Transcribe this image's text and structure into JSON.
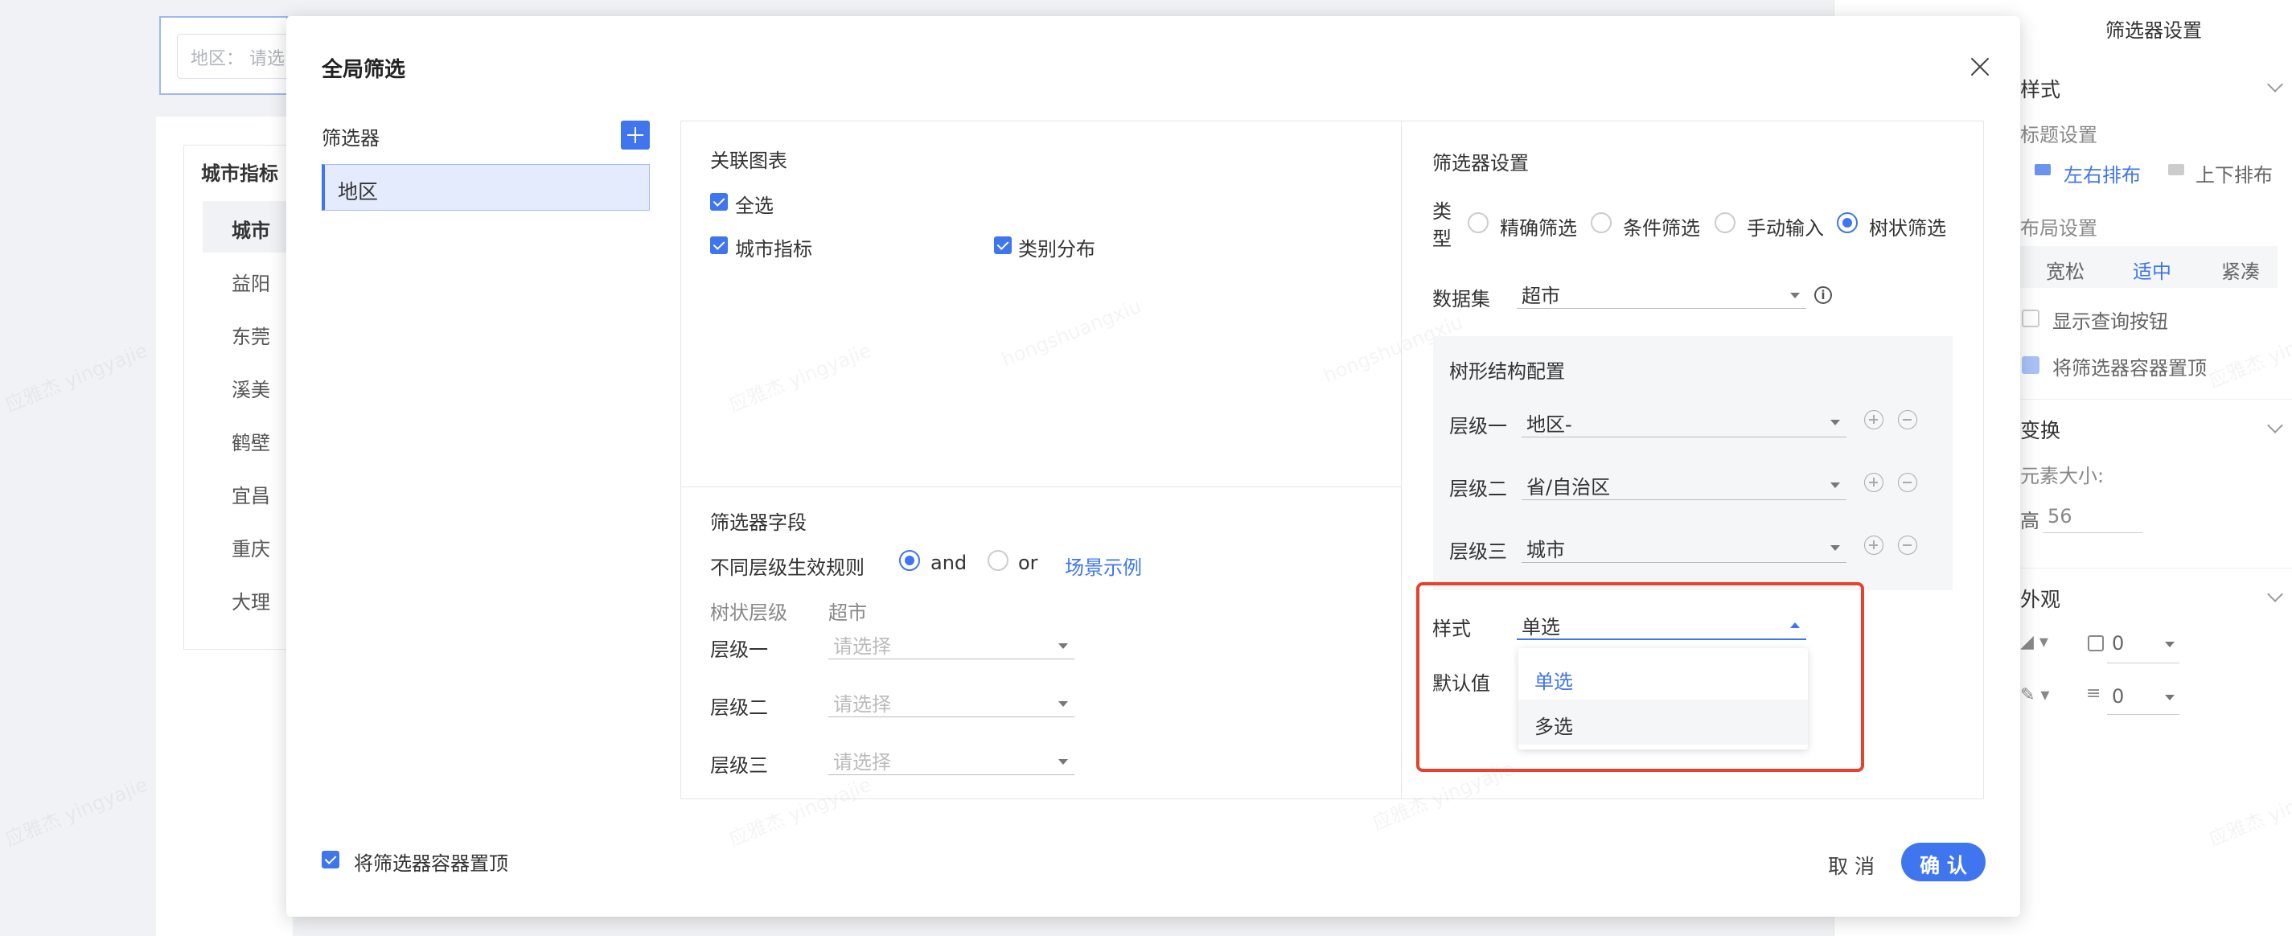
{
  "background": {
    "region_filter_placeholder": "地区： 请选",
    "card_title": "城市指标",
    "table_header": "城市",
    "rows": [
      "益阳",
      "东莞",
      "溪美",
      "鹤壁",
      "宜昌",
      "重庆",
      "大理"
    ]
  },
  "right_panel": {
    "title": "筛选器设置",
    "style_section": "样式",
    "title_setting": "标题设置",
    "layout_lr": "左右排布",
    "layout_tb": "上下排布",
    "layout_setting": "布局设置",
    "loose": "宽松",
    "medium": "适中",
    "compact": "紧凑",
    "show_query_btn": "显示查询按钮",
    "pin_top": "将筛选器容器置顶",
    "transform_section": "变换",
    "element_size": "元素大小:",
    "height_label": "高",
    "height_value": "56",
    "appearance_section": "外观",
    "fill_value": "0",
    "stroke_value": "0"
  },
  "dialog": {
    "title": "全局筛选",
    "filters_label": "筛选器",
    "filter_items": [
      "地区"
    ],
    "linked_charts": {
      "title": "关联图表",
      "select_all": "全选",
      "charts": [
        "城市指标",
        "类别分布"
      ]
    },
    "filter_fields": {
      "title": "筛选器字段",
      "rule_label": "不同层级生效规则",
      "rule_and": "and",
      "rule_or": "or",
      "scenario_link": "场景示例",
      "tree_level_header": "树状层级",
      "dataset_header": "超市",
      "levels": [
        "层级一",
        "层级二",
        "层级三"
      ],
      "placeholder": "请选择"
    },
    "settings": {
      "title": "筛选器设置",
      "type_label": "类型",
      "type_options": [
        "精确筛选",
        "条件筛选",
        "手动输入",
        "树状筛选"
      ],
      "type_selected": "树状筛选",
      "dataset_label": "数据集",
      "dataset_value": "超市",
      "tree_config_title": "树形结构配置",
      "tree_levels": [
        {
          "label": "层级一",
          "value": "地区-"
        },
        {
          "label": "层级二",
          "value": "省/自治区"
        },
        {
          "label": "层级三",
          "value": "城市"
        }
      ],
      "style_label": "样式",
      "style_value": "单选",
      "default_label": "默认值",
      "style_options": [
        "单选",
        "多选"
      ]
    },
    "pin_top_label": "将筛选器容器置顶",
    "cancel_label": "取 消",
    "confirm_label": "确 认"
  },
  "colors": {
    "accent": "#3f75ee",
    "highlight_border": "#e8412c"
  }
}
